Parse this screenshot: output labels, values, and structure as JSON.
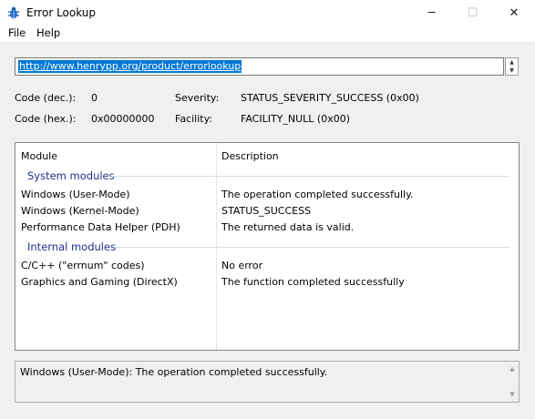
{
  "window": {
    "title": "Error Lookup",
    "icon": "bug-icon",
    "controls": {
      "minimize": "─",
      "maximize": "☐",
      "close": "✕"
    }
  },
  "menu": {
    "file": "File",
    "help": "Help"
  },
  "url": {
    "value": "http://www.henrypp.org/product/errorlookup",
    "spin_up": "▲",
    "spin_down": "▼"
  },
  "code_info": {
    "dec_label": "Code (dec.):",
    "dec_value": "0",
    "hex_label": "Code (hex.):",
    "hex_value": "0x00000000",
    "severity_label": "Severity:",
    "severity_value": "STATUS_SEVERITY_SUCCESS (0x00)",
    "facility_label": "Facility:",
    "facility_value": "FACILITY_NULL (0x00)"
  },
  "table": {
    "columns": [
      "Module",
      "Description"
    ],
    "groups": [
      {
        "name": "System modules",
        "rows": [
          {
            "module": "Windows (User-Mode)",
            "description": "The operation completed successfully."
          },
          {
            "module": "Windows (Kernel-Mode)",
            "description": "STATUS_SUCCESS"
          },
          {
            "module": "Performance Data Helper (PDH)",
            "description": "The returned data is valid."
          }
        ]
      },
      {
        "name": "Internal modules",
        "rows": [
          {
            "module": "C/C++ (\"errnum\" codes)",
            "description": "No error"
          },
          {
            "module": "Graphics and Gaming (DirectX)",
            "description": "The function completed successfully"
          }
        ]
      }
    ]
  },
  "status": {
    "text": "Windows (User-Mode): The operation completed successfully."
  },
  "colors": {
    "selection": "#0078d7",
    "group_header": "#1e3287"
  }
}
